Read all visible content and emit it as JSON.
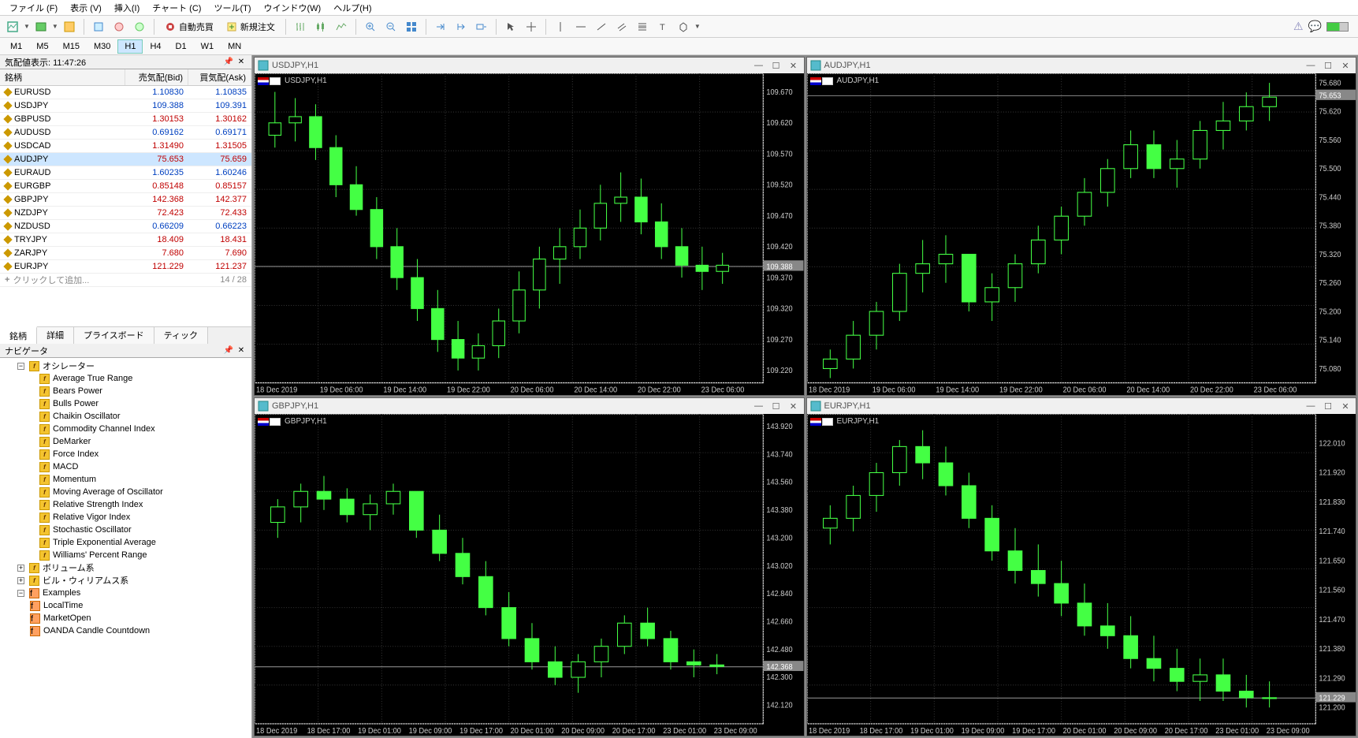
{
  "menu": {
    "file": "ファイル (F)",
    "view": "表示 (V)",
    "insert": "挿入(I)",
    "chart": "チャート (C)",
    "tools": "ツール(T)",
    "window": "ウインドウ(W)",
    "help": "ヘルプ(H)"
  },
  "toolbar": {
    "autotrade": "自動売買",
    "neworder": "新規注文"
  },
  "timeframes": [
    "M1",
    "M5",
    "M15",
    "M30",
    "H1",
    "H4",
    "D1",
    "W1",
    "MN"
  ],
  "active_tf": "H1",
  "market_watch": {
    "title_prefix": "気配値表示:",
    "time": "11:47:26",
    "head": {
      "sym": "銘柄",
      "bid": "売気配(Bid)",
      "ask": "買気配(Ask)"
    },
    "rows": [
      {
        "sym": "EURUSD",
        "bid": "1.10830",
        "ask": "1.10835",
        "c": "blue"
      },
      {
        "sym": "USDJPY",
        "bid": "109.388",
        "ask": "109.391",
        "c": "blue"
      },
      {
        "sym": "GBPUSD",
        "bid": "1.30153",
        "ask": "1.30162",
        "c": "red"
      },
      {
        "sym": "AUDUSD",
        "bid": "0.69162",
        "ask": "0.69171",
        "c": "blue"
      },
      {
        "sym": "USDCAD",
        "bid": "1.31490",
        "ask": "1.31505",
        "c": "red"
      },
      {
        "sym": "AUDJPY",
        "bid": "75.653",
        "ask": "75.659",
        "c": "red",
        "sel": true
      },
      {
        "sym": "EURAUD",
        "bid": "1.60235",
        "ask": "1.60246",
        "c": "blue"
      },
      {
        "sym": "EURGBP",
        "bid": "0.85148",
        "ask": "0.85157",
        "c": "red"
      },
      {
        "sym": "GBPJPY",
        "bid": "142.368",
        "ask": "142.377",
        "c": "red"
      },
      {
        "sym": "NZDJPY",
        "bid": "72.423",
        "ask": "72.433",
        "c": "red"
      },
      {
        "sym": "NZDUSD",
        "bid": "0.66209",
        "ask": "0.66223",
        "c": "blue"
      },
      {
        "sym": "TRYJPY",
        "bid": "18.409",
        "ask": "18.431",
        "c": "red"
      },
      {
        "sym": "ZARJPY",
        "bid": "7.680",
        "ask": "7.690",
        "c": "red"
      },
      {
        "sym": "EURJPY",
        "bid": "121.229",
        "ask": "121.237",
        "c": "red"
      }
    ],
    "add": "クリックして追加...",
    "count": "14 / 28",
    "tabs": [
      "銘柄",
      "詳細",
      "プライスボード",
      "ティック"
    ]
  },
  "navigator": {
    "title": "ナビゲータ",
    "oscillators": "オシレーター",
    "items": [
      "Average True Range",
      "Bears Power",
      "Bulls Power",
      "Chaikin Oscillator",
      "Commodity Channel Index",
      "DeMarker",
      "Force Index",
      "MACD",
      "Momentum",
      "Moving Average of Oscillator",
      "Relative Strength Index",
      "Relative Vigor Index",
      "Stochastic Oscillator",
      "Triple Exponential Average",
      "Williams' Percent Range"
    ],
    "volume": "ボリューム系",
    "williams": "ビル・ウィリアムス系",
    "examples": "Examples",
    "ex_items": [
      "LocalTime",
      "MarketOpen",
      "OANDA Candle Countdown"
    ]
  },
  "charts": [
    {
      "title": "USDJPY,H1",
      "price": "109.388",
      "ymin": 109.2,
      "ymax": 109.7,
      "ylabels": [
        "109.670",
        "109.620",
        "109.570",
        "109.520",
        "109.470",
        "109.420",
        "109.388",
        "109.370",
        "109.320",
        "109.270",
        "109.220"
      ],
      "xlabels": [
        "18 Dec 2019",
        "19 Dec 06:00",
        "19 Dec 14:00",
        "19 Dec 22:00",
        "20 Dec 06:00",
        "20 Dec 14:00",
        "20 Dec 22:00",
        "23 Dec 06:00"
      ]
    },
    {
      "title": "AUDJPY,H1",
      "price": "75.653",
      "ymin": 75.05,
      "ymax": 75.7,
      "ylabels": [
        "75.680",
        "75.653",
        "75.620",
        "75.560",
        "75.500",
        "75.440",
        "75.380",
        "75.320",
        "75.260",
        "75.200",
        "75.140",
        "75.080"
      ],
      "xlabels": [
        "18 Dec 2019",
        "19 Dec 06:00",
        "19 Dec 14:00",
        "19 Dec 22:00",
        "20 Dec 06:00",
        "20 Dec 14:00",
        "20 Dec 22:00",
        "23 Dec 06:00"
      ]
    },
    {
      "title": "GBPJPY,H1",
      "price": "142.368",
      "ymin": 142.0,
      "ymax": 144.0,
      "ylabels": [
        "143.920",
        "143.740",
        "143.560",
        "143.380",
        "143.200",
        "143.020",
        "142.840",
        "142.660",
        "142.480",
        "142.368",
        "142.300",
        "142.120"
      ],
      "xlabels": [
        "18 Dec 2019",
        "18 Dec 17:00",
        "19 Dec 01:00",
        "19 Dec 09:00",
        "19 Dec 17:00",
        "20 Dec 01:00",
        "20 Dec 09:00",
        "20 Dec 17:00",
        "23 Dec 01:00",
        "23 Dec 09:00"
      ]
    },
    {
      "title": "EURJPY,H1",
      "price": "121.229",
      "ymin": 121.15,
      "ymax": 122.1,
      "ylabels": [
        "122.010",
        "121.920",
        "121.830",
        "121.740",
        "121.650",
        "121.560",
        "121.470",
        "121.380",
        "121.290",
        "121.229",
        "121.200"
      ],
      "xlabels": [
        "18 Dec 2019",
        "18 Dec 17:00",
        "19 Dec 01:00",
        "19 Dec 09:00",
        "19 Dec 17:00",
        "20 Dec 01:00",
        "20 Dec 09:00",
        "20 Dec 17:00",
        "23 Dec 01:00",
        "23 Dec 09:00"
      ]
    }
  ],
  "chart_data": [
    {
      "type": "candlestick",
      "title": "USDJPY,H1",
      "current": 109.388,
      "ylim": [
        109.2,
        109.7
      ],
      "candles": [
        [
          109.6,
          109.67,
          109.58,
          109.62
        ],
        [
          109.62,
          109.66,
          109.59,
          109.63
        ],
        [
          109.63,
          109.65,
          109.56,
          109.58
        ],
        [
          109.58,
          109.6,
          109.5,
          109.52
        ],
        [
          109.52,
          109.55,
          109.47,
          109.48
        ],
        [
          109.48,
          109.5,
          109.4,
          109.42
        ],
        [
          109.42,
          109.45,
          109.35,
          109.37
        ],
        [
          109.37,
          109.4,
          109.3,
          109.32
        ],
        [
          109.32,
          109.35,
          109.25,
          109.27
        ],
        [
          109.27,
          109.3,
          109.22,
          109.24
        ],
        [
          109.24,
          109.28,
          109.22,
          109.26
        ],
        [
          109.26,
          109.32,
          109.24,
          109.3
        ],
        [
          109.3,
          109.38,
          109.28,
          109.35
        ],
        [
          109.35,
          109.42,
          109.32,
          109.4
        ],
        [
          109.4,
          109.45,
          109.36,
          109.42
        ],
        [
          109.42,
          109.48,
          109.4,
          109.45
        ],
        [
          109.45,
          109.52,
          109.43,
          109.49
        ],
        [
          109.49,
          109.54,
          109.46,
          109.5
        ],
        [
          109.5,
          109.53,
          109.44,
          109.46
        ],
        [
          109.46,
          109.49,
          109.4,
          109.42
        ],
        [
          109.42,
          109.45,
          109.37,
          109.39
        ],
        [
          109.39,
          109.42,
          109.35,
          109.38
        ],
        [
          109.38,
          109.41,
          109.36,
          109.39
        ]
      ]
    },
    {
      "type": "candlestick",
      "title": "AUDJPY,H1",
      "current": 75.653,
      "ylim": [
        75.05,
        75.7
      ],
      "candles": [
        [
          75.08,
          75.12,
          75.06,
          75.1
        ],
        [
          75.1,
          75.18,
          75.08,
          75.15
        ],
        [
          75.15,
          75.22,
          75.12,
          75.2
        ],
        [
          75.2,
          75.3,
          75.18,
          75.28
        ],
        [
          75.28,
          75.35,
          75.24,
          75.3
        ],
        [
          75.3,
          75.36,
          75.26,
          75.32
        ],
        [
          75.32,
          75.28,
          75.2,
          75.22
        ],
        [
          75.22,
          75.28,
          75.18,
          75.25
        ],
        [
          75.25,
          75.32,
          75.22,
          75.3
        ],
        [
          75.3,
          75.38,
          75.28,
          75.35
        ],
        [
          75.35,
          75.42,
          75.32,
          75.4
        ],
        [
          75.4,
          75.48,
          75.38,
          75.45
        ],
        [
          75.45,
          75.52,
          75.42,
          75.5
        ],
        [
          75.5,
          75.58,
          75.48,
          75.55
        ],
        [
          75.55,
          75.58,
          75.48,
          75.5
        ],
        [
          75.5,
          75.56,
          75.46,
          75.52
        ],
        [
          75.52,
          75.6,
          75.5,
          75.58
        ],
        [
          75.58,
          75.64,
          75.54,
          75.6
        ],
        [
          75.6,
          75.66,
          75.58,
          75.63
        ],
        [
          75.63,
          75.68,
          75.6,
          75.65
        ]
      ]
    },
    {
      "type": "candlestick",
      "title": "GBPJPY,H1",
      "current": 142.368,
      "ylim": [
        142.0,
        144.0
      ],
      "candles": [
        [
          143.3,
          143.45,
          143.2,
          143.4
        ],
        [
          143.4,
          143.55,
          143.3,
          143.5
        ],
        [
          143.5,
          143.6,
          143.38,
          143.45
        ],
        [
          143.45,
          143.52,
          143.3,
          143.35
        ],
        [
          143.35,
          143.48,
          143.25,
          143.42
        ],
        [
          143.42,
          143.55,
          143.35,
          143.5
        ],
        [
          143.5,
          143.45,
          143.2,
          143.25
        ],
        [
          143.25,
          143.35,
          143.05,
          143.1
        ],
        [
          143.1,
          143.2,
          142.9,
          142.95
        ],
        [
          142.95,
          143.05,
          142.7,
          142.75
        ],
        [
          142.75,
          142.85,
          142.5,
          142.55
        ],
        [
          142.55,
          142.65,
          142.35,
          142.4
        ],
        [
          142.4,
          142.5,
          142.25,
          142.3
        ],
        [
          142.3,
          142.45,
          142.2,
          142.4
        ],
        [
          142.4,
          142.55,
          142.3,
          142.5
        ],
        [
          142.5,
          142.7,
          142.45,
          142.65
        ],
        [
          142.65,
          142.75,
          142.5,
          142.55
        ],
        [
          142.55,
          142.6,
          142.35,
          142.4
        ],
        [
          142.4,
          142.48,
          142.3,
          142.38
        ],
        [
          142.38,
          142.45,
          142.32,
          142.37
        ]
      ]
    },
    {
      "type": "candlestick",
      "title": "EURJPY,H1",
      "current": 121.229,
      "ylim": [
        121.15,
        122.1
      ],
      "candles": [
        [
          121.75,
          121.82,
          121.7,
          121.78
        ],
        [
          121.78,
          121.88,
          121.74,
          121.85
        ],
        [
          121.85,
          121.95,
          121.8,
          121.92
        ],
        [
          121.92,
          122.02,
          121.88,
          122.0
        ],
        [
          122.0,
          122.05,
          121.9,
          121.95
        ],
        [
          121.95,
          122.0,
          121.85,
          121.88
        ],
        [
          121.88,
          121.92,
          121.75,
          121.78
        ],
        [
          121.78,
          121.82,
          121.65,
          121.68
        ],
        [
          121.68,
          121.75,
          121.58,
          121.62
        ],
        [
          121.62,
          121.7,
          121.54,
          121.58
        ],
        [
          121.58,
          121.65,
          121.48,
          121.52
        ],
        [
          121.52,
          121.58,
          121.42,
          121.45
        ],
        [
          121.45,
          121.52,
          121.38,
          121.42
        ],
        [
          121.42,
          121.48,
          121.32,
          121.35
        ],
        [
          121.35,
          121.42,
          121.28,
          121.32
        ],
        [
          121.32,
          121.38,
          121.25,
          121.28
        ],
        [
          121.28,
          121.35,
          121.22,
          121.3
        ],
        [
          121.3,
          121.35,
          121.22,
          121.25
        ],
        [
          121.25,
          121.3,
          121.2,
          121.23
        ],
        [
          121.23,
          121.28,
          121.2,
          121.23
        ]
      ]
    }
  ]
}
